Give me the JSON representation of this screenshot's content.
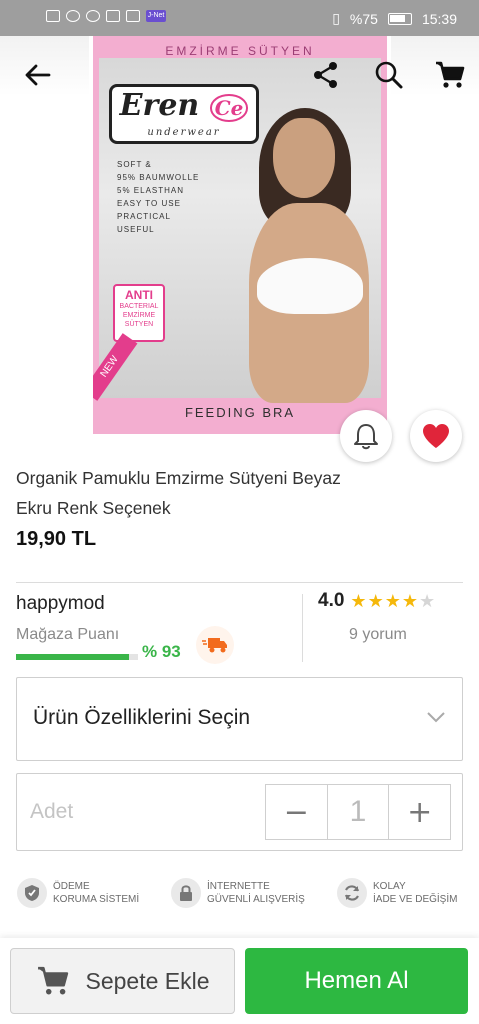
{
  "status_bar": {
    "battery": "%75",
    "time": "15:39",
    "app_tag": "J-Net"
  },
  "nav": {
    "back_icon": "arrow-left-icon",
    "share_icon": "share-icon",
    "search_icon": "search-icon",
    "cart_icon": "cart-icon"
  },
  "product_image": {
    "top_text": "EMZİRME SÜTYEN",
    "brand": "Eren",
    "brand_mark": "Ce",
    "brand_sub": "underwear",
    "features": [
      "SOFT &",
      "95% BAUMWOLLE",
      "5% ELASTHAN",
      "EASY TO USE",
      "PRACTICAL",
      "USEFUL"
    ],
    "badge_title": "ANTI",
    "badge_line2": "BACTERIAL",
    "badge_line3": "EMZİRME",
    "badge_line4": "SÜTYEN",
    "ribbon": "NEW",
    "bottom_text": "FEEDING BRA"
  },
  "actions": {
    "notify_icon": "bell-icon",
    "favorite_icon": "heart-icon"
  },
  "product": {
    "title_line1": "Organik Pamuklu Emzirme Sütyeni Beyaz",
    "title_line2": "Ekru Renk Seçenek",
    "price": "19,90 TL"
  },
  "seller": {
    "name": "happymod",
    "score_label": "Mağaza Puanı",
    "score_value": "% 93",
    "score_percent": 93,
    "truck_icon": "fast-delivery-icon"
  },
  "rating": {
    "value": "4.0",
    "stars_filled": 4,
    "stars_total": 5,
    "reviews": "9 yorum"
  },
  "options": {
    "select_label": "Ürün Özelliklerini Seçin",
    "chevron_icon": "chevron-down-icon"
  },
  "quantity": {
    "label": "Adet",
    "value": "1",
    "minus": "−",
    "plus": "+"
  },
  "trust": [
    {
      "icon": "shield-check-icon",
      "line1": "ÖDEME",
      "line2": "KORUMA SİSTEMİ"
    },
    {
      "icon": "lock-icon",
      "line1": "İNTERNETTE",
      "line2": "GÜVENLİ ALIŞVERİŞ"
    },
    {
      "icon": "refresh-icon",
      "line1": "KOLAY",
      "line2": "İADE VE DEĞİŞİM"
    }
  ],
  "bottom_bar": {
    "add_to_cart": "Sepete Ekle",
    "buy_now": "Hemen Al"
  },
  "colors": {
    "accent_green": "#2db841",
    "favorite_red": "#e0253a",
    "star_gold": "#f5b80b",
    "truck_orange": "#f26b1d"
  }
}
